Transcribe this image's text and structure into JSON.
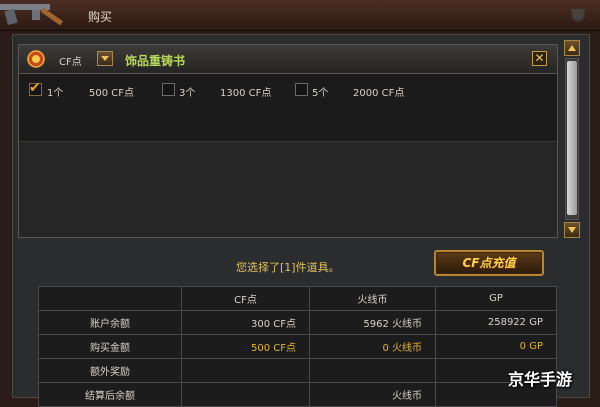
{
  "titlebar": {
    "title": "购买"
  },
  "item": {
    "currency": "CF点",
    "name": "饰品重铸书",
    "options": [
      {
        "qty": "1个",
        "price": "500 CF点",
        "checked": true
      },
      {
        "qty": "3个",
        "price": "1300 CF点",
        "checked": false
      },
      {
        "qty": "5个",
        "price": "2000 CF点",
        "checked": false
      }
    ]
  },
  "selection_text": "您选择了[1]件道具。",
  "recharge_label": "CF点充值",
  "table": {
    "headers": [
      "",
      "CF点",
      "火线币",
      "GP"
    ],
    "rows": [
      {
        "label": "账户余额",
        "values": [
          "300 CF点",
          "5962 火线币",
          "258922 GP"
        ],
        "highlight": false
      },
      {
        "label": "购买金额",
        "values": [
          "500 CF点",
          "0 火线币",
          "0 GP"
        ],
        "highlight": true
      },
      {
        "label": "额外奖励",
        "values": [
          "",
          "",
          ""
        ],
        "highlight": false
      },
      {
        "label": "结算后余额",
        "values": [
          "",
          "火线币",
          ""
        ],
        "highlight": false
      }
    ]
  },
  "watermark": "京华手游",
  "colors": {
    "accent_gold": "#e0b52d",
    "item_name_green": "#b6d85a"
  }
}
